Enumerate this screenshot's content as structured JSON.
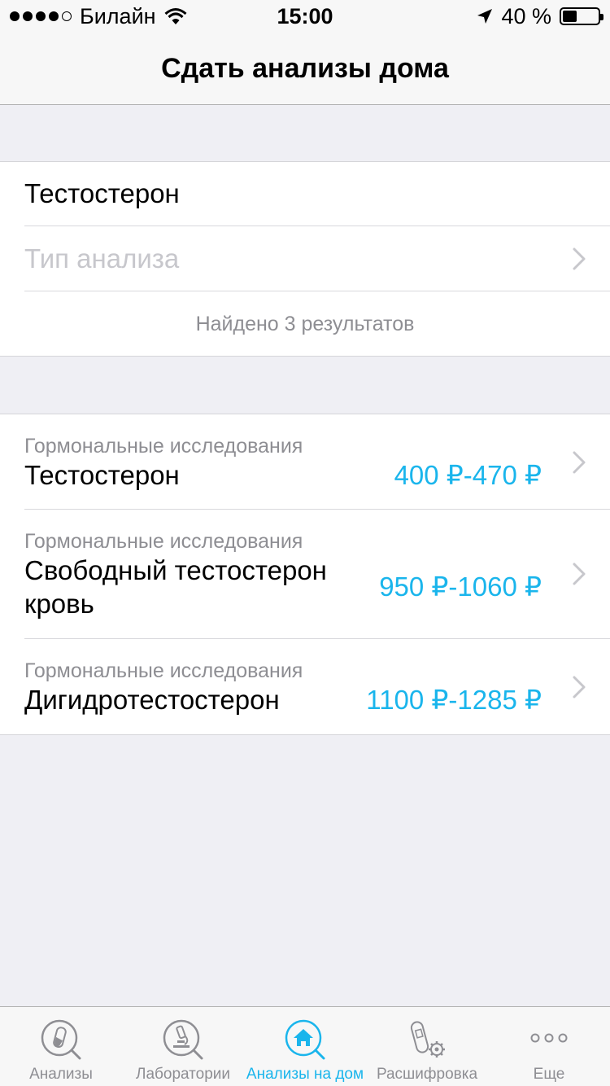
{
  "status_bar": {
    "carrier": "Билайн",
    "time": "15:00",
    "battery_text": "40 %",
    "battery_level": 0.4
  },
  "nav": {
    "title": "Сдать анализы дома"
  },
  "filter": {
    "search_value": "Тестостерон",
    "type_placeholder": "Тип анализа",
    "found_text": "Найдено 3 результатов"
  },
  "results": [
    {
      "category": "Гормональные исследования",
      "name": "Тестостерон",
      "price": "400 ₽-470 ₽"
    },
    {
      "category": "Гормональные исследования",
      "name_line1": "Свободный тестостерон",
      "name_line2": "кровь",
      "price": "950 ₽-1060 ₽"
    },
    {
      "category": "Гормональные исследования",
      "name": "Дигидротестостерон",
      "price": "1100 ₽-1285 ₽"
    }
  ],
  "tabs": [
    {
      "label": "Анализы",
      "icon": "test-tube-search-icon"
    },
    {
      "label": "Лаборатории",
      "icon": "microscope-search-icon"
    },
    {
      "label": "Анализы на дом",
      "icon": "home-search-icon",
      "active": true
    },
    {
      "label": "Расшифровка",
      "icon": "test-tube-gear-icon"
    },
    {
      "label": "Еще",
      "icon": "more-dots-icon"
    }
  ],
  "colors": {
    "accent": "#1ab5ec",
    "background": "#efeff4",
    "secondary_text": "#8e8e93"
  }
}
